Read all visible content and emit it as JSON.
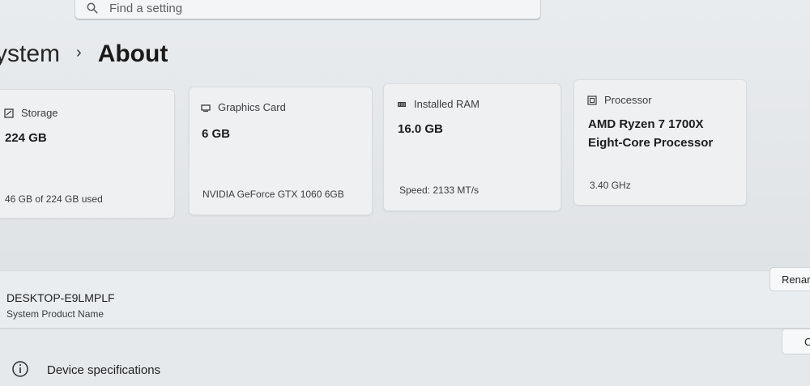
{
  "search": {
    "placeholder": "Find a setting",
    "icon": "search-icon"
  },
  "breadcrumb": {
    "parent": "ystem",
    "separator": "›",
    "current": "About"
  },
  "specs_cards": [
    {
      "icon": "storage-icon",
      "label": "Storage",
      "value": "224 GB",
      "detail": "46 GB of 224 GB used"
    },
    {
      "icon": "graphics-card-icon",
      "label": "Graphics Card",
      "value": "6 GB",
      "detail": "NVIDIA GeForce GTX 1060 6GB"
    },
    {
      "icon": "ram-icon",
      "label": "Installed RAM",
      "value": "16.0 GB",
      "detail": "Speed: 2133 MT/s"
    },
    {
      "icon": "processor-icon",
      "label": "Processor",
      "value_line1": "AMD Ryzen 7 1700X",
      "value_line2": "Eight-Core Processor",
      "detail": "3.40 GHz"
    }
  ],
  "device": {
    "name": "DESKTOP-E9LMPLF",
    "subtitle": "System Product Name",
    "rename_label": "Renar"
  },
  "device_specs": {
    "title": "Device specifications",
    "copy_label": "C",
    "icon": "info-icon"
  }
}
